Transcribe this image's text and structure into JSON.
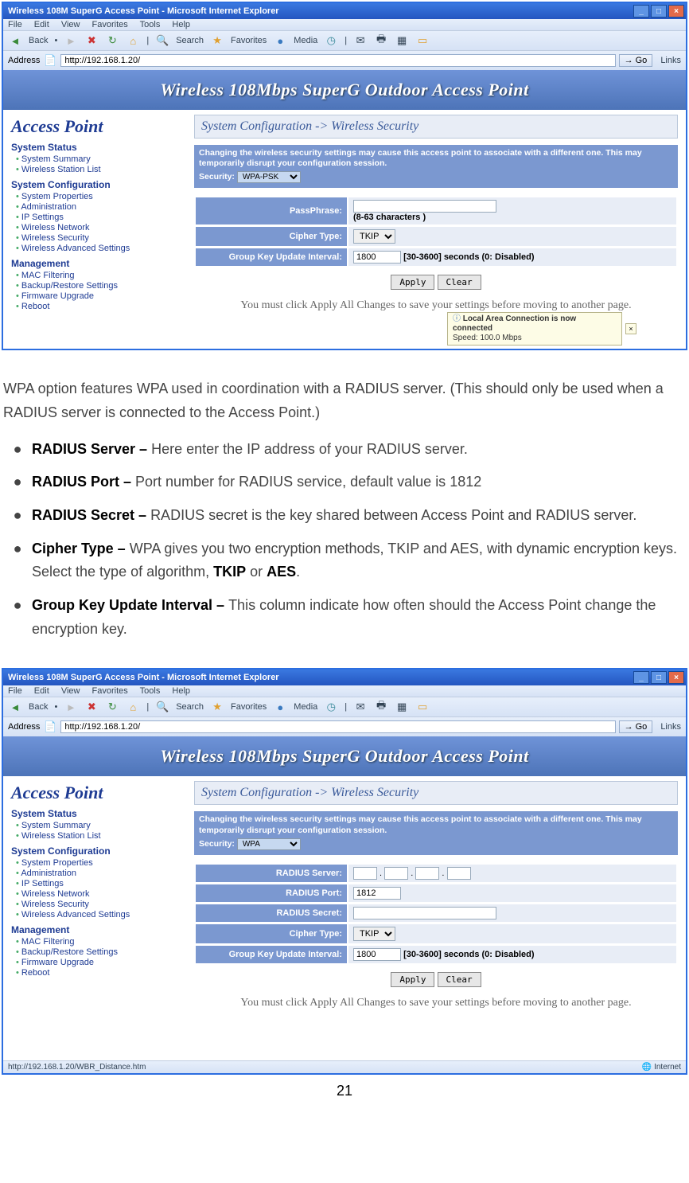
{
  "browser": {
    "title": "Wireless 108M SuperG Access Point - Microsoft Internet Explorer",
    "menus": [
      "File",
      "Edit",
      "View",
      "Favorites",
      "Tools",
      "Help"
    ],
    "toolbar": {
      "back": "Back",
      "search": "Search",
      "favorites": "Favorites",
      "media": "Media"
    },
    "addr_label": "Address",
    "addr_value": "http://192.168.1.20/",
    "go": "Go",
    "links": "Links"
  },
  "router_header": "Wireless 108Mbps SuperG Outdoor Access Point",
  "sidebar": {
    "title": "Access Point",
    "sections": [
      {
        "heading": "System Status",
        "items": [
          "System Summary",
          "Wireless Station List"
        ]
      },
      {
        "heading": "System Configuration",
        "items": [
          "System Properties",
          "Administration",
          "IP Settings",
          "Wireless Network",
          "Wireless Security",
          "Wireless Advanced Settings"
        ]
      },
      {
        "heading": "Management",
        "items": [
          "MAC Filtering",
          "Backup/Restore Settings",
          "Firmware Upgrade",
          "Reboot"
        ]
      }
    ]
  },
  "breadcrumb": "System Configuration -> Wireless Security",
  "warn_text": "Changing the wireless security settings may cause this access point to associate with a different one. This may temporarily disrupt your configuration session.",
  "security_label": "Security:",
  "shot1": {
    "security_value": "WPA-PSK",
    "fields": {
      "pass_label": "PassPhrase:",
      "pass_hint": "(8-63 characters )",
      "cipher_label": "Cipher Type:",
      "cipher_value": "TKIP",
      "gku_label": "Group Key Update Interval:",
      "gku_value": "1800",
      "gku_hint": "[30-3600] seconds (0: Disabled)"
    },
    "apply": "Apply",
    "clear": "Clear",
    "note": "You must click Apply All Changes to save your settings before moving to another page.",
    "tray_title": "Local Area Connection is now connected",
    "tray_sub": "Speed: 100.0 Mbps"
  },
  "doc": {
    "intro": "WPA option features WPA used in coordination with a RADIUS server. (This should only be used when a RADIUS server is connected to the Access Point.)",
    "items": [
      {
        "b": "RADIUS Server – ",
        "t": "Here enter the IP address of your RADIUS server."
      },
      {
        "b": "RADIUS Port – ",
        "t": "Port number for RADIUS service, default value is 1812"
      },
      {
        "b": "RADIUS Secret – ",
        "t": "RADIUS secret is the key shared between Access Point and RADIUS server."
      },
      {
        "b": "Cipher Type – ",
        "t": "WPA gives you two encryption methods, TKIP and AES, with dynamic encryption keys. Select the type of algorithm, ",
        "b2": "TKIP",
        "t2": " or ",
        "b3": "AES",
        "t3": "."
      },
      {
        "b": "Group Key Update Interval – ",
        "t": "This column indicate how often should the Access Point change the encryption key."
      }
    ]
  },
  "shot2": {
    "security_value": "WPA",
    "fields": {
      "rserver_label": "RADIUS Server:",
      "rport_label": "RADIUS Port:",
      "rport_value": "1812",
      "rsecret_label": "RADIUS Secret:",
      "cipher_label": "Cipher Type:",
      "cipher_value": "TKIP",
      "gku_label": "Group Key Update Interval:",
      "gku_value": "1800",
      "gku_hint": "[30-3600] seconds (0: Disabled)"
    },
    "apply": "Apply",
    "clear": "Clear",
    "note": "You must click Apply All Changes to save your settings before moving to another page.",
    "status_left": "http://192.168.1.20/WBR_Distance.htm",
    "status_right": "Internet"
  },
  "page_number": "21"
}
